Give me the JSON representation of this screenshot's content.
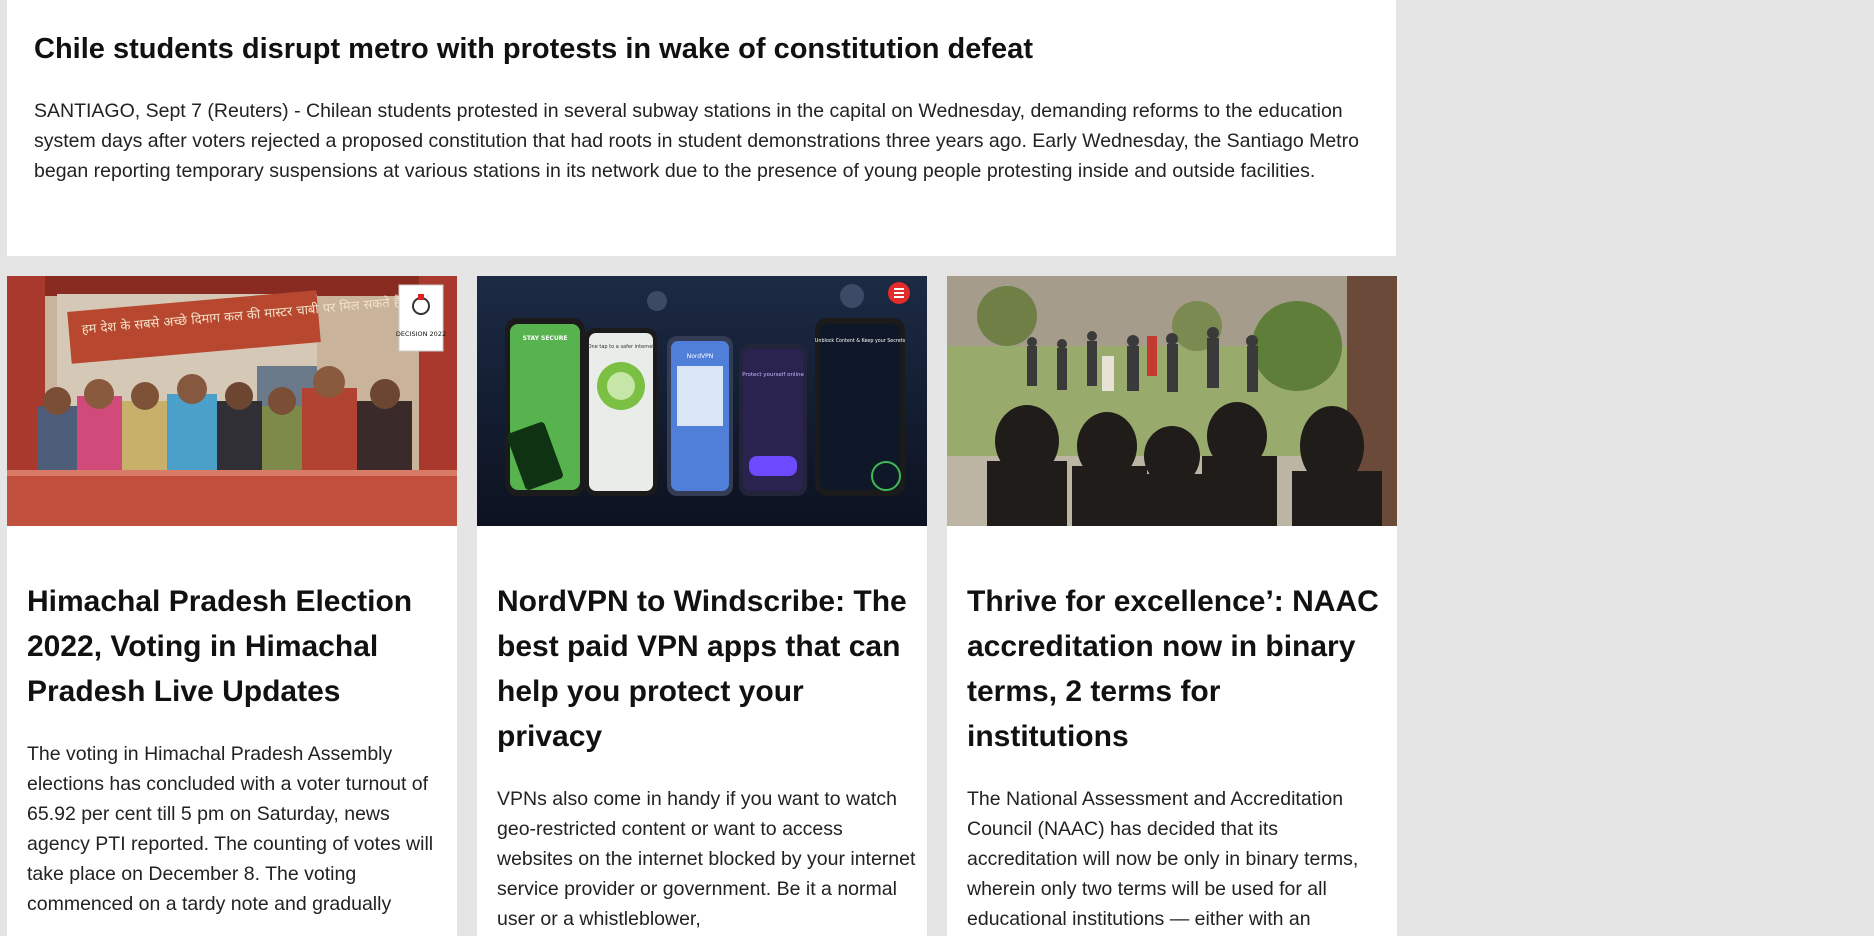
{
  "top_story": {
    "title": "Chile students disrupt metro with protests in wake of constitution defeat",
    "body": "SANTIAGO, Sept 7 (Reuters) - Chilean students protested in several subway stations in the capital on Wednesday, demanding reforms to the education system days after voters rejected a proposed constitution that had roots in student demonstrations three years ago. Early Wednesday, the Santiago Metro began reporting temporary suspensions at various stations in its network due to the presence of young people protesting inside and outside facilities."
  },
  "cards": [
    {
      "title": "Himachal Pradesh Election 2022, Voting in Himachal Pradesh Live Updates",
      "body": "The voting in Himachal Pradesh Assembly elections has concluded with a voter turnout of 65.92 per cent till 5 pm on Saturday, news agency PTI reported. The counting of votes will take place on December 8. The voting commenced on a tardy note and gradually",
      "image": {
        "banner_text": "हम देश के सबसे अच्छे दिमाग कल की मास्टर चाबी पर मिल सकते हैं",
        "badge": "DECISION 2022"
      }
    },
    {
      "title": "NordVPN to Windscribe: The best paid VPN apps that can help you protect your privacy",
      "body": "VPNs also come in handy if you want to watch geo-restricted content or want to access websites on the internet blocked by your internet service provider or government. Be it a normal user or a whistleblower,",
      "image": {
        "phone_labels": [
          "STAY SECURE",
          "One tap to a safer internet",
          "NordVPN",
          "Protect yourself online",
          "Unblock Content & Keep your Secrets"
        ]
      }
    },
    {
      "title": "Thrive for excellence’: NAAC accreditation now in binary terms, 2 terms for institutions",
      "body": "The National Assessment and Accreditation Council (NAAC) has decided that its accreditation will now be only in binary terms, wherein only two terms will be used for all educational institutions — either with an"
    }
  ]
}
